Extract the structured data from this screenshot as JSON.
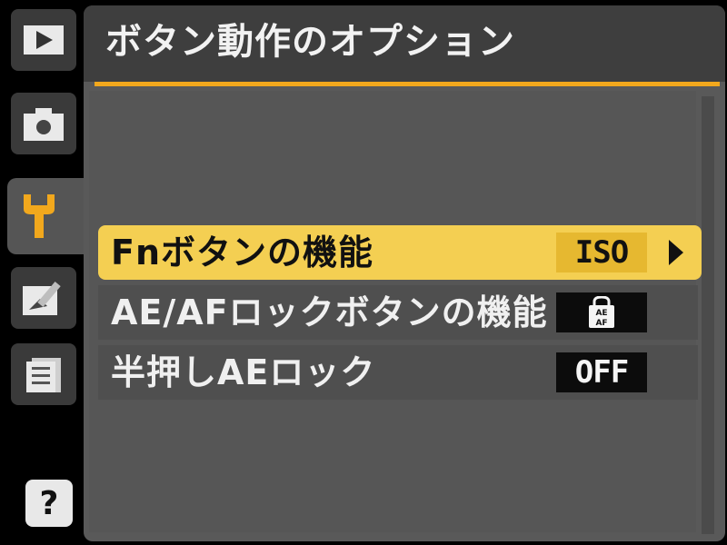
{
  "header": {
    "title": "ボタン動作のオプション"
  },
  "sidebar": {
    "tabs": [
      {
        "name": "playback",
        "icon": "playback-icon"
      },
      {
        "name": "shooting",
        "icon": "camera-icon"
      },
      {
        "name": "setup",
        "icon": "wrench-icon",
        "active": true
      },
      {
        "name": "retouch",
        "icon": "retouch-icon"
      },
      {
        "name": "recent",
        "icon": "recent-settings-icon"
      }
    ],
    "help_label": "?"
  },
  "menu": {
    "items": [
      {
        "label": "Fnボタンの機能",
        "value": "ISO",
        "selected": true,
        "has_arrow": true
      },
      {
        "label": "AE/AFロックボタンの機能",
        "value": "AE AF",
        "value_icon": "ae-af-lock-icon",
        "selected": false
      },
      {
        "label": "半押しAEロック",
        "value": "OFF",
        "selected": false
      }
    ]
  },
  "colors": {
    "accent": "#f2a81d",
    "selected_row": "#f4cf52",
    "panel": "#595959",
    "header": "#3e3e3e"
  }
}
